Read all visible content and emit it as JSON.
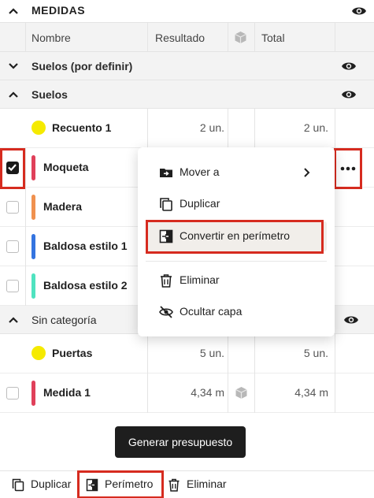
{
  "panel": {
    "title": "MEDIDAS"
  },
  "columns": {
    "name": "Nombre",
    "result": "Resultado",
    "total": "Total"
  },
  "groups": [
    {
      "label": "Suelos (por definir)"
    },
    {
      "label": "Suelos"
    },
    {
      "label": "Sin categoría"
    }
  ],
  "items": [
    {
      "name": "Recuento 1",
      "result": "2 un.",
      "total": "2 un.",
      "color": "#f5ea00"
    },
    {
      "name": "Moqueta",
      "checked": true,
      "color": "#e0405a"
    },
    {
      "name": "Madera",
      "color": "#f0914f"
    },
    {
      "name": "Baldosa estilo 1",
      "color": "#3474e0"
    },
    {
      "name": "Baldosa estilo 2",
      "color": "#4fe3c0"
    },
    {
      "name": "Puertas",
      "result": "5 un.",
      "total": "5 un.",
      "color": "#f5ea00"
    },
    {
      "name": "Medida 1",
      "result": "4,34 m",
      "total": "4,34 m",
      "color": "#e0405a"
    }
  ],
  "context_menu": {
    "move_to": "Mover a",
    "duplicate": "Duplicar",
    "convert_perimeter": "Convertir en perímetro",
    "delete": "Eliminar",
    "hide_layer": "Ocultar capa"
  },
  "actions": {
    "generate_budget": "Generar presupuesto",
    "duplicate": "Duplicar",
    "perimeter": "Perímetro",
    "delete": "Eliminar"
  },
  "colors": {
    "highlight": "#d62b1f",
    "button_dark": "#1e1e1e"
  }
}
